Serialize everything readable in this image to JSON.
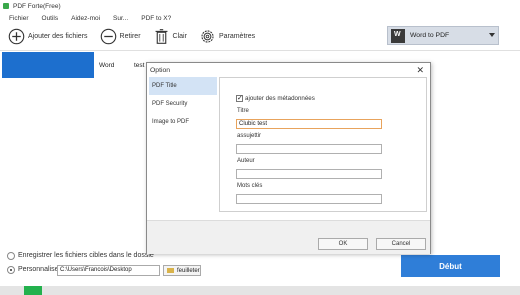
{
  "window": {
    "title": "PDF Forte(Free)"
  },
  "menu": [
    "Fichier",
    "Outils",
    "Aidez-moi",
    "Sur...",
    "PDF to X?"
  ],
  "toolbar": {
    "add_label": "Ajouter des fichiers",
    "remove_label": "Retirer",
    "clear_label": "Clair",
    "settings_label": "Paramètres",
    "convert_selected": "Word to PDF"
  },
  "file_list": {
    "rows": [
      {
        "type": "Word",
        "name": "test"
      }
    ]
  },
  "output": {
    "same_folder_label": "Enregistrer les fichiers cibles dans le dossie",
    "custom_label": "Personnaliser:",
    "path_value": "C:\\Users\\Francois\\Desktop",
    "browse_label": "feuilleter"
  },
  "start_label": "Début",
  "dialog": {
    "title": "Option",
    "close": "✕",
    "sidebar": [
      "PDF Title",
      "PDF Security",
      "Image to PDF"
    ],
    "add_metadata_label": "ajouter des métadonnées",
    "fields": {
      "title_label": "Titre",
      "title_value": "Clubic test",
      "subject_label": "assujettir",
      "subject_value": "",
      "author_label": "Auteur",
      "author_value": "",
      "keywords_label": "Mots clés",
      "keywords_value": ""
    },
    "ok_label": "OK",
    "cancel_label": "Cancel"
  },
  "colors": {
    "accent": "#2f7ed8",
    "selected_row": "#1d6fce",
    "progress": "#23b14d"
  }
}
